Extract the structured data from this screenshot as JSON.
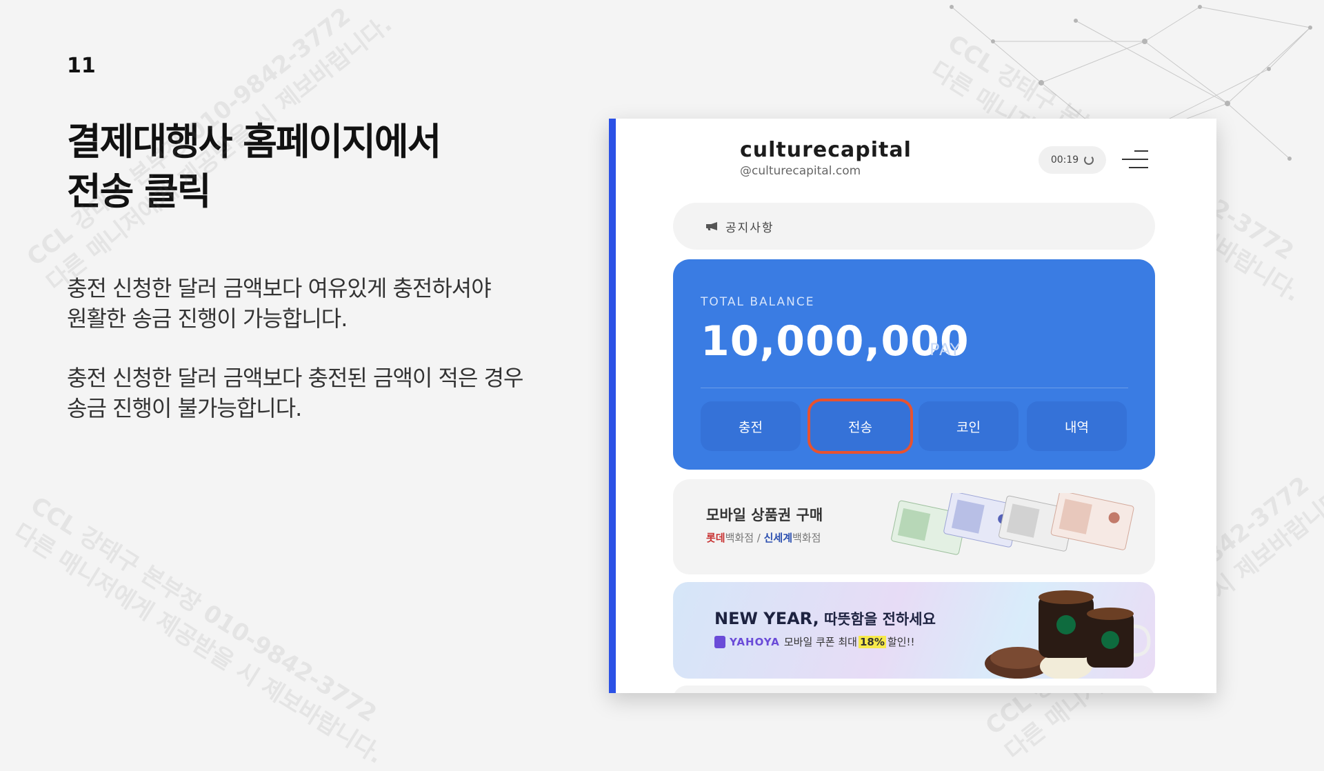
{
  "slide": {
    "number": "11",
    "title_line1": "결제대행사 홈페이지에서",
    "title_line2": "전송 클릭",
    "desc1_line1": "충전 신청한 달러 금액보다 여유있게 충전하셔야",
    "desc1_line2": "원활한 송금 진행이 가능합니다.",
    "desc2_line1": "충전 신청한 달러 금액보다 충전된 금액이 적은 경우",
    "desc2_line2": "송금 진행이 불가능합니다."
  },
  "watermark": {
    "line1": "CCL 강태구 본부장 010-9842-3772",
    "line2": "다른 매니저에게 제공받을 시 제보바랍니다."
  },
  "app": {
    "brand_name": "culturecapital",
    "brand_domain": "@culturecapital.com",
    "timer": "00:19",
    "notice_label": "공지사항",
    "balance_label": "TOTAL BALANCE",
    "balance_value": "10,000,000",
    "balance_unit": "PAY",
    "buttons": {
      "charge": "충전",
      "send": "전송",
      "coin": "코인",
      "history": "내역"
    },
    "gift": {
      "title": "모바일 상품권 구매",
      "sub_lotte": "롯데",
      "sub_dept1": "백화점 / ",
      "sub_shinsegae": "신세계",
      "sub_dept2": "백화점"
    },
    "promo": {
      "title_bold": "NEW YEAR,",
      "title_rest": " 따뜻함을 전하세요",
      "brand": "YAHOYA",
      "sub_pre": "모바일 쿠폰 최대",
      "discount": "18%",
      "sub_post": "할인!!"
    }
  },
  "colors": {
    "accent_bar": "#2b51e6",
    "balance_card": "#3a7ce3",
    "highlight_border": "#e8522f"
  }
}
